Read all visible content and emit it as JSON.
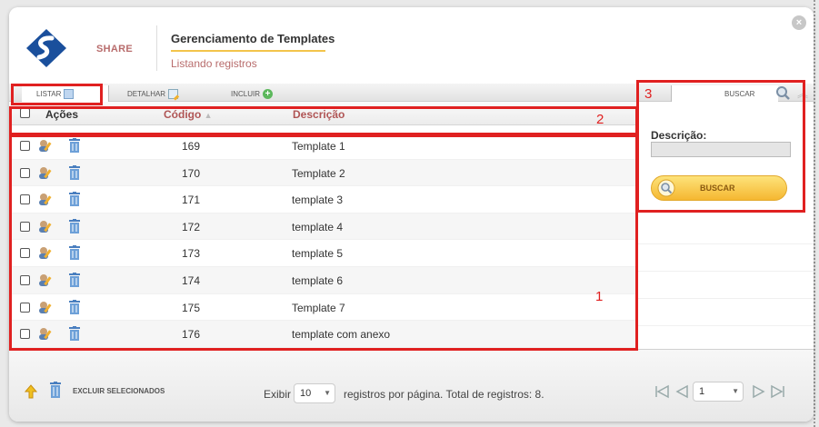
{
  "header": {
    "brand": "SHARE",
    "title": "Gerenciamento de Templates",
    "subtitle": "Listando registros",
    "close_icon": "close-icon"
  },
  "tabs": [
    {
      "label": "LISTAR",
      "icon": "list-icon"
    },
    {
      "label": "DETALHAR",
      "icon": "edit-icon"
    },
    {
      "label": "INCLUIR",
      "icon": "add-icon"
    }
  ],
  "table": {
    "headers": {
      "acoes": "Ações",
      "codigo": "Código",
      "descricao": "Descrição"
    },
    "rows": [
      {
        "codigo": "169",
        "descricao": "Template 1"
      },
      {
        "codigo": "170",
        "descricao": "Template 2"
      },
      {
        "codigo": "171",
        "descricao": "template 3"
      },
      {
        "codigo": "172",
        "descricao": "template 4"
      },
      {
        "codigo": "173",
        "descricao": "template 5"
      },
      {
        "codigo": "174",
        "descricao": "template 6"
      },
      {
        "codigo": "175",
        "descricao": "Template 7"
      },
      {
        "codigo": "176",
        "descricao": "template com anexo"
      }
    ]
  },
  "search": {
    "tab_label": "BUSCAR",
    "field_label": "Descrição:",
    "field_value": "",
    "button_label": "BUSCAR"
  },
  "footer": {
    "delete_label": "EXCLUIR SELECIONADOS",
    "show_label": "Exibir",
    "page_size": "10",
    "records_label": "registros por página. Total de registros: 8.",
    "current_page": "1"
  },
  "annotations": [
    "1",
    "2",
    "3"
  ],
  "colors": {
    "accent": "#b05555",
    "button": "#f5b731",
    "annotation": "#e02020"
  }
}
